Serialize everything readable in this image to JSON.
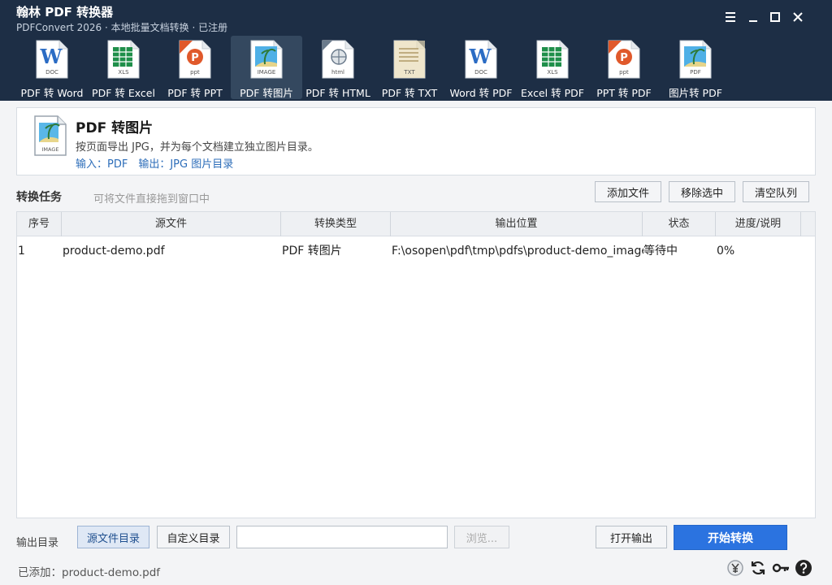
{
  "window": {
    "title": "翰林 PDF 转换器",
    "subtitle": "PDFConvert 2026 · 本地批量文档转换 · 已注册"
  },
  "toolbar": [
    {
      "label": "PDF 转 Word",
      "icon": "word-doc-icon",
      "tag": "DOC",
      "color": "#2b6cc4"
    },
    {
      "label": "PDF 转 Excel",
      "icon": "excel-xls-icon",
      "tag": "XLS",
      "color": "#1f8f4a"
    },
    {
      "label": "PDF 转 PPT",
      "icon": "ppt-icon",
      "tag": "ppt",
      "color": "#e0592b"
    },
    {
      "label": "PDF 转图片",
      "icon": "image-icon",
      "tag": "IMAGE",
      "color": "#2a9fd6"
    },
    {
      "label": "PDF 转 HTML",
      "icon": "html-icon",
      "tag": "html",
      "color": "#6b7b8c"
    },
    {
      "label": "PDF 转 TXT",
      "icon": "txt-icon",
      "tag": "TXT",
      "color": "#b9a77a"
    },
    {
      "label": "Word 转 PDF",
      "icon": "word-doc-icon",
      "tag": "DOC",
      "color": "#2b6cc4"
    },
    {
      "label": "Excel 转 PDF",
      "icon": "excel-xls-icon",
      "tag": "XLS",
      "color": "#1f8f4a"
    },
    {
      "label": "PPT 转 PDF",
      "icon": "ppt-icon",
      "tag": "ppt",
      "color": "#e0592b"
    },
    {
      "label": "图片转 PDF",
      "icon": "image-pdf-icon",
      "tag": "PDF",
      "color": "#2a9fd6"
    }
  ],
  "active_tool_index": 3,
  "info": {
    "title": "PDF 转图片",
    "icon_tag": "IMAGE",
    "description": "按页面导出 JPG，并为每个文档建立独立图片目录。",
    "io": "输入：PDF　输出：JPG 图片目录"
  },
  "task": {
    "title": "转换任务",
    "hint": "可将文件直接拖到窗口中",
    "add_label": "添加文件",
    "remove_label": "移除选中",
    "clear_label": "清空队列"
  },
  "table": {
    "columns": [
      "序号",
      "源文件",
      "转换类型",
      "输出位置",
      "状态",
      "进度/说明"
    ],
    "rows": [
      {
        "index": "1",
        "source": "product-demo.pdf",
        "type": "PDF 转图片",
        "output": "F:\\osopen\\pdf\\tmp\\pdfs\\product-demo_images",
        "status": "等待中",
        "progress": "0%"
      }
    ]
  },
  "output": {
    "label": "输出目录",
    "source_dir_label": "源文件目录",
    "custom_dir_label": "自定义目录",
    "path_value": "",
    "browse_label": "浏览...",
    "open_label": "打开输出",
    "start_label": "开始转换"
  },
  "status": {
    "text": "已添加：product-demo.pdf"
  }
}
